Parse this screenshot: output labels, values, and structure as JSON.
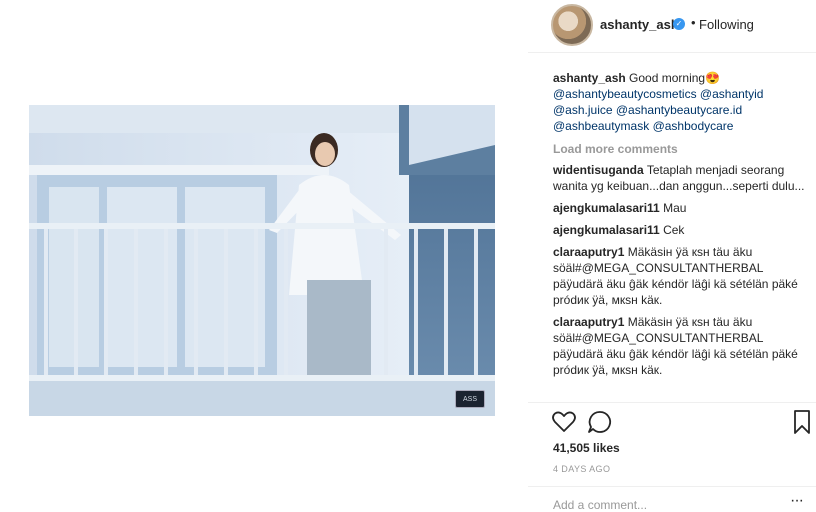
{
  "post": {
    "username": "ashanty_ash",
    "follow_status": "Following",
    "bullet": "•",
    "watermark": "ASS"
  },
  "caption": {
    "user": "ashanty_ash",
    "text": "Good morning😍",
    "mentions_line1": "@ashantybeautycosmetics @ashantyid",
    "mentions_line2": "@ash.juice @ashantybeautycare.id",
    "mentions_line3": "@ashbeautymask @ashbodycare"
  },
  "load_more": "Load more comments",
  "comments": [
    {
      "user": "widentisuganda",
      "text": "Tetaplah menjadi seorang wanita yg keibuan...dan anggun...seperti dulu..."
    },
    {
      "user": "ajengkumalasari11",
      "text": "Mau"
    },
    {
      "user": "ajengkumalasari11",
      "text": "Cek"
    },
    {
      "user": "claraaputry1",
      "text": "Mäkäsiн ÿä кsн täu äku söäl#@MEGA_CONSULTANTHERBAL päÿudärä äku ĝäk kéndör läĝi kä sétélän päké pródик ÿä, мкsн käк."
    },
    {
      "user": "claraaputry1",
      "text": "Mäkäsiн ÿä кsн täu äku söäl#@MEGA_CONSULTANTHERBAL päÿudärä äku ĝäk kéndör läĝi kä sétélän päké pródик ÿä, мкsн käк."
    }
  ],
  "likes": "41,505 likes",
  "time_ago": "4 DAYS AGO",
  "add_comment_placeholder": "Add a comment...",
  "more_dots": "···",
  "icons": [
    "heart-icon",
    "comment-icon",
    "bookmark-icon",
    "verified-icon"
  ],
  "colors": {
    "accent": "#3897f0",
    "mention": "#003569",
    "muted": "#999999"
  }
}
